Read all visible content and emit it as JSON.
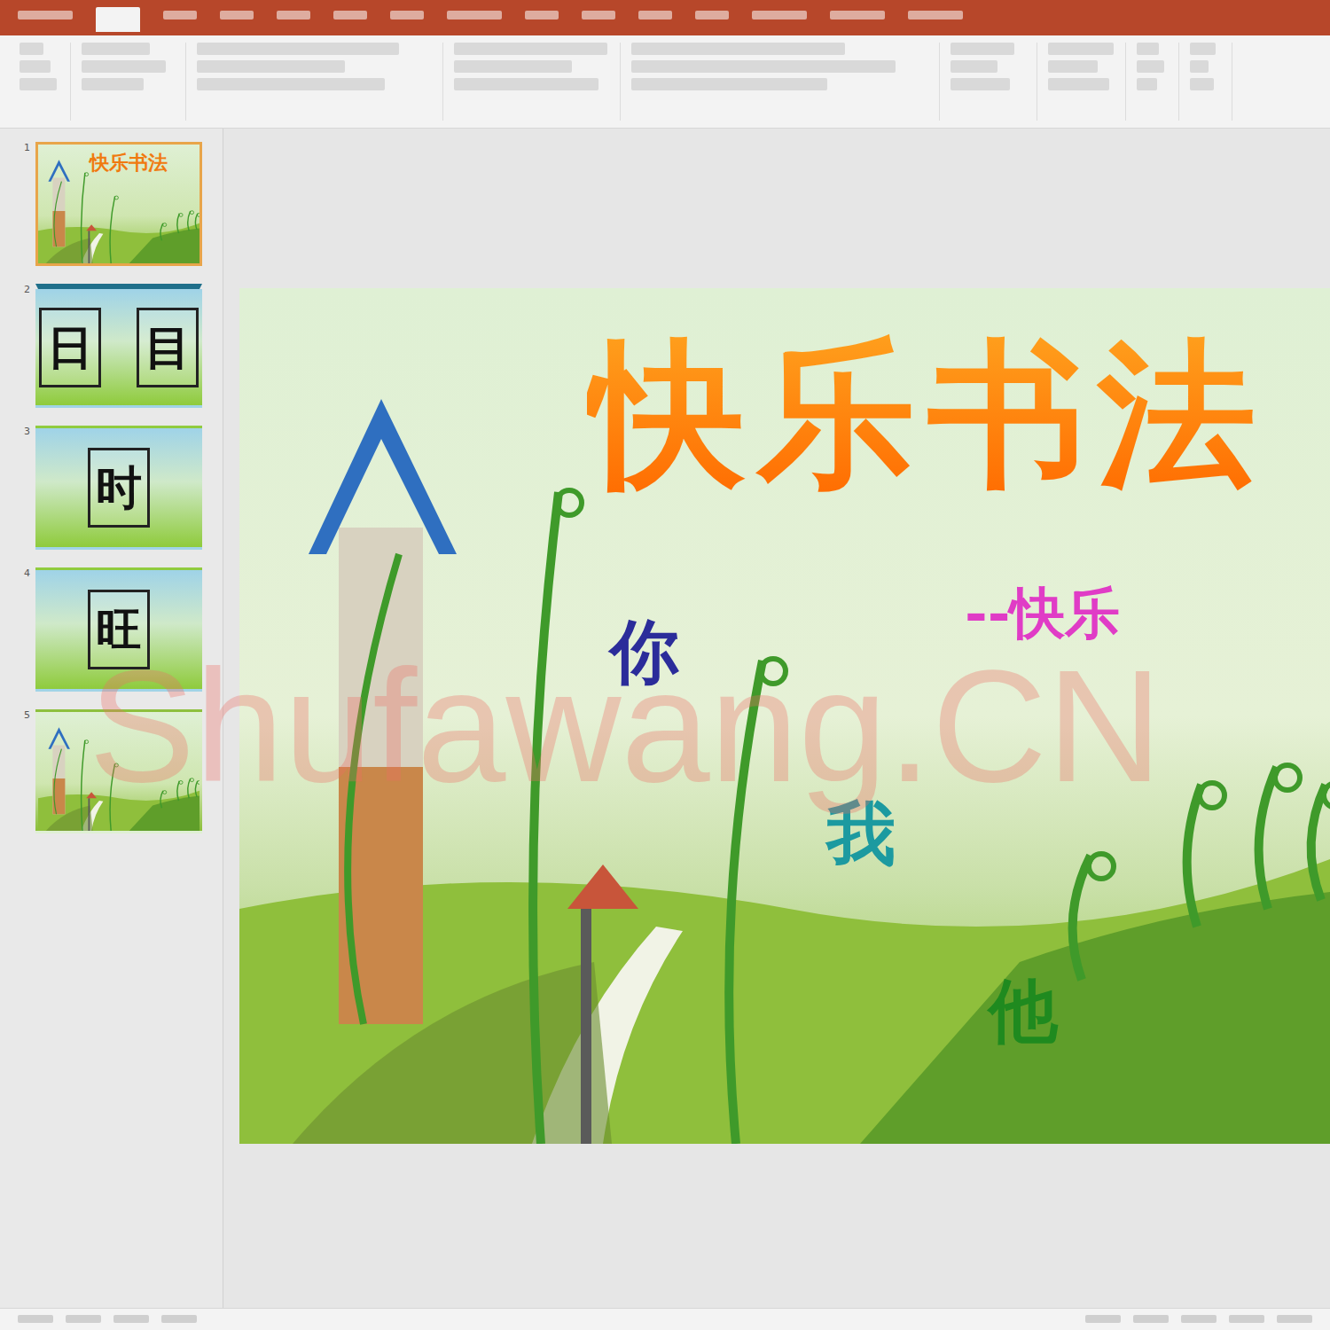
{
  "thumbnails": [
    {
      "number": "1",
      "kind": "title",
      "selected": true,
      "texts": [
        "快乐书法"
      ]
    },
    {
      "number": "2",
      "kind": "grid",
      "selected": false,
      "texts": [
        "日",
        "目"
      ]
    },
    {
      "number": "3",
      "kind": "grid",
      "selected": false,
      "texts": [
        "时"
      ]
    },
    {
      "number": "4",
      "kind": "grid",
      "selected": false,
      "texts": [
        "旺"
      ]
    },
    {
      "number": "5",
      "kind": "picture",
      "selected": false,
      "texts": []
    }
  ],
  "slide": {
    "title": "快乐书法",
    "subtitle": "--快乐",
    "words": [
      {
        "text": "你",
        "color": "#2b2c9a"
      },
      {
        "text": "我",
        "color": "#1c9aa0"
      },
      {
        "text": "他",
        "color": "#1f8a1f"
      }
    ]
  },
  "watermark": "Shufawang.CN"
}
